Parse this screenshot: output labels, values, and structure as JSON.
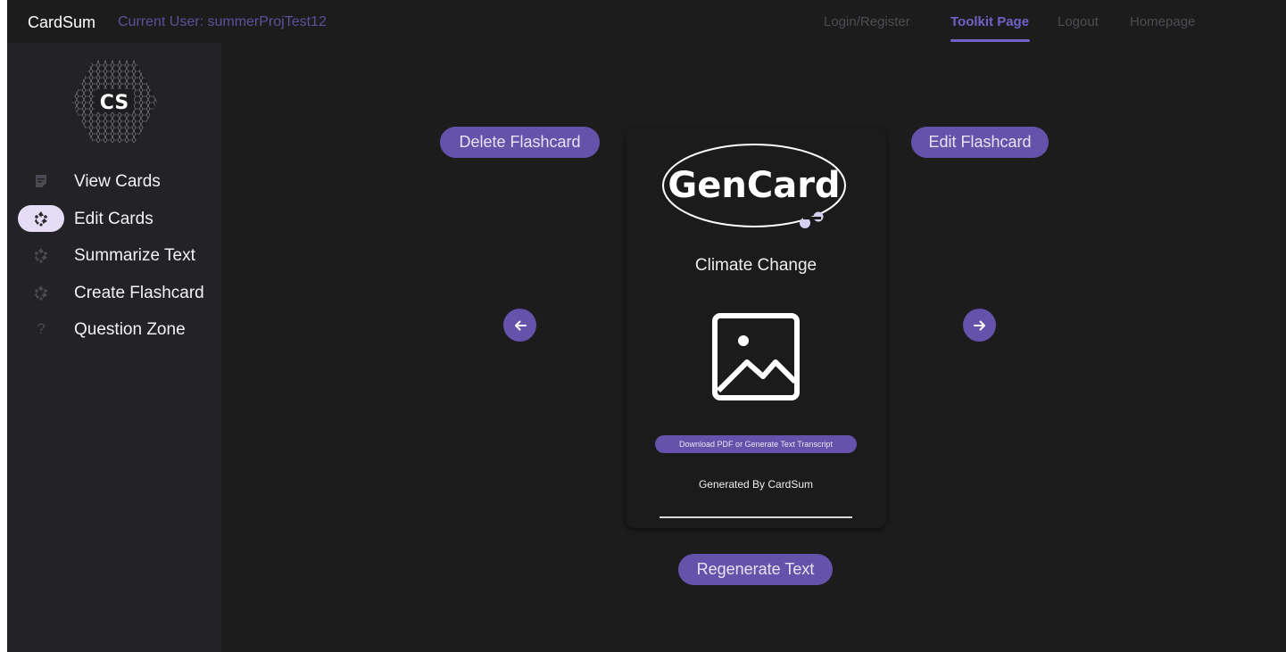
{
  "topbar": {
    "brand": "CardSum",
    "current_user": "Current User: summerProjTest12",
    "nav": [
      {
        "label": "Login/Register",
        "active": false
      },
      {
        "label": "Toolkit Page",
        "active": true
      },
      {
        "label": "Logout",
        "active": false
      },
      {
        "label": "Homepage",
        "active": false
      }
    ]
  },
  "sidebar": {
    "logo_text": "CS",
    "items": [
      {
        "label": "View Cards",
        "icon": "note-icon"
      },
      {
        "label": "Edit Cards",
        "icon": "recycle-icon",
        "active": true
      },
      {
        "label": "Summarize Text",
        "icon": "recycle-icon"
      },
      {
        "label": "Create Flashcard",
        "icon": "recycle-icon"
      },
      {
        "label": "Question Zone",
        "icon": "question-icon"
      }
    ]
  },
  "main": {
    "delete_label": "Delete Flashcard",
    "edit_label": "Edit Flashcard",
    "regenerate_label": "Regenerate Text",
    "prev_icon": "arrow-left-icon",
    "next_icon": "arrow-right-icon"
  },
  "card": {
    "logo_text": "GenCard",
    "title": "Climate Change",
    "image_icon": "image-placeholder-icon",
    "download_label": "Download PDF or Generate Text Transcript",
    "generated_by": "Generated By CardSum"
  },
  "colors": {
    "accent": "#6552aa",
    "nav_active": "#6f62c6",
    "background": "#1c1c1d",
    "sidebar": "#232327"
  }
}
